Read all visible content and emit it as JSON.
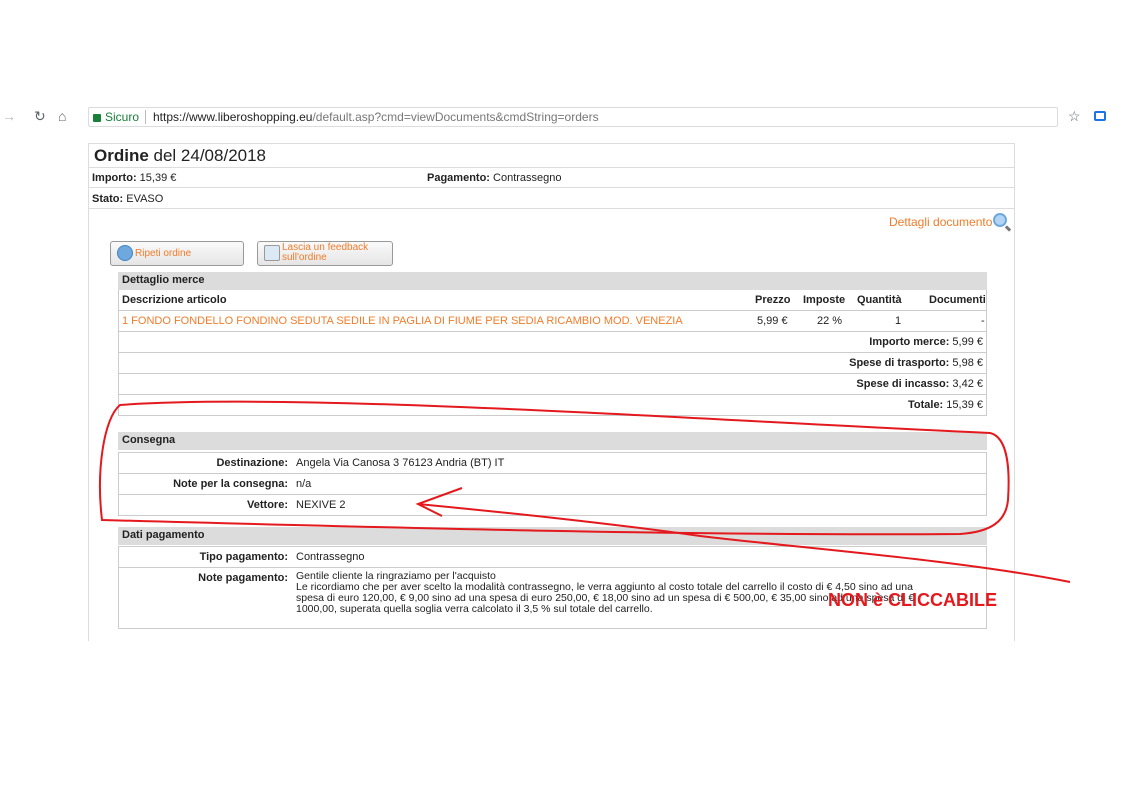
{
  "browser": {
    "secure_label": "Sicuro",
    "url_host": "https://www.liberoshopping.eu",
    "url_path": "/default.asp?cmd=viewDocuments&cmdString=orders"
  },
  "order": {
    "title_bold": "Ordine",
    "title_rest": " del 24/08/2018",
    "importo_label": "Importo:",
    "importo_value": " 15,39 €",
    "pagamento_label": "Pagamento:",
    "pagamento_value": " Contrassegno",
    "stato_label": "Stato:",
    "stato_value": " EVASO",
    "dettagli_documento": "Dettagli documento"
  },
  "buttons": {
    "ripeti": "Ripeti ordine",
    "feedback_line1": "Lascia un feedback",
    "feedback_line2": "sull'ordine"
  },
  "merce": {
    "header": "Dettaglio merce",
    "columns": [
      "Descrizione articolo",
      "Prezzo",
      "Imposte",
      "Quantità",
      "Documenti"
    ],
    "item": {
      "descrizione": "1 FONDO FONDELLO FONDINO SEDUTA SEDILE IN PAGLIA DI FIUME PER SEDIA RICAMBIO MOD. VENEZIA",
      "prezzo": "5,99 €",
      "imposte": "22 %",
      "quantita": "1",
      "documenti": "-"
    },
    "totals": [
      {
        "label": "Importo merce:",
        "value": " 5,99 €"
      },
      {
        "label": "Spese di trasporto:",
        "value": " 5,98 €"
      },
      {
        "label": "Spese di incasso:",
        "value": " 3,42 €"
      },
      {
        "label": "Totale:",
        "value": " 15,39 €"
      }
    ]
  },
  "consegna": {
    "header": "Consegna",
    "rows": [
      {
        "label": "Destinazione:",
        "value": "Angela Via Canosa 3 76123 Andria (BT) IT"
      },
      {
        "label": "Note per la consegna:",
        "value": "n/a"
      },
      {
        "label": "Vettore:",
        "value": "NEXIVE 2"
      }
    ]
  },
  "pagamento": {
    "header": "Dati pagamento",
    "tipo_label": "Tipo pagamento:",
    "tipo_value": "Contrassegno",
    "note_label": "Note pagamento:",
    "note_lines": [
      "Gentile cliente la ringraziamo per l'acquisto",
      "Le ricordiamo che per aver scelto la modalità contrassegno, le verra aggiunto al costo totale del carrello il costo di € 4,50 sino ad una",
      "spesa di euro 120,00, € 9,00 sino ad una spesa di euro 250,00, € 18,00 sino ad un spesa di € 500,00, € 35,00 sino ad una spesa di €",
      "1000,00, superata  quella soglia verra calcolato il 3,5 % sul totale del carrello."
    ]
  },
  "annotation": {
    "text": "NON è CLICCABILE",
    "color": "#e3191d"
  }
}
